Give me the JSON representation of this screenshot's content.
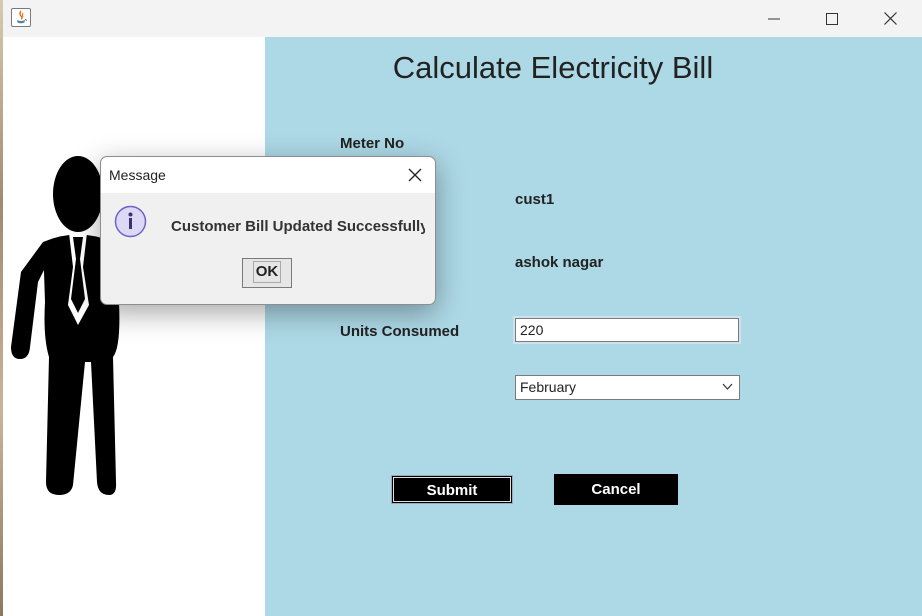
{
  "form": {
    "heading": "Calculate Electricity Bill",
    "meter_label": "Meter No",
    "name_value": "cust1",
    "address_value": "ashok nagar",
    "units_label": "Units Consumed",
    "units_value": "220",
    "month_selected": "February",
    "submit_label": "Submit",
    "cancel_label": "Cancel"
  },
  "dialog": {
    "title": "Message",
    "message": "Customer Bill Updated Successfully",
    "ok_label": "OK"
  },
  "colors": {
    "panel_bg": "#add8e6",
    "button_bg": "#000000"
  }
}
